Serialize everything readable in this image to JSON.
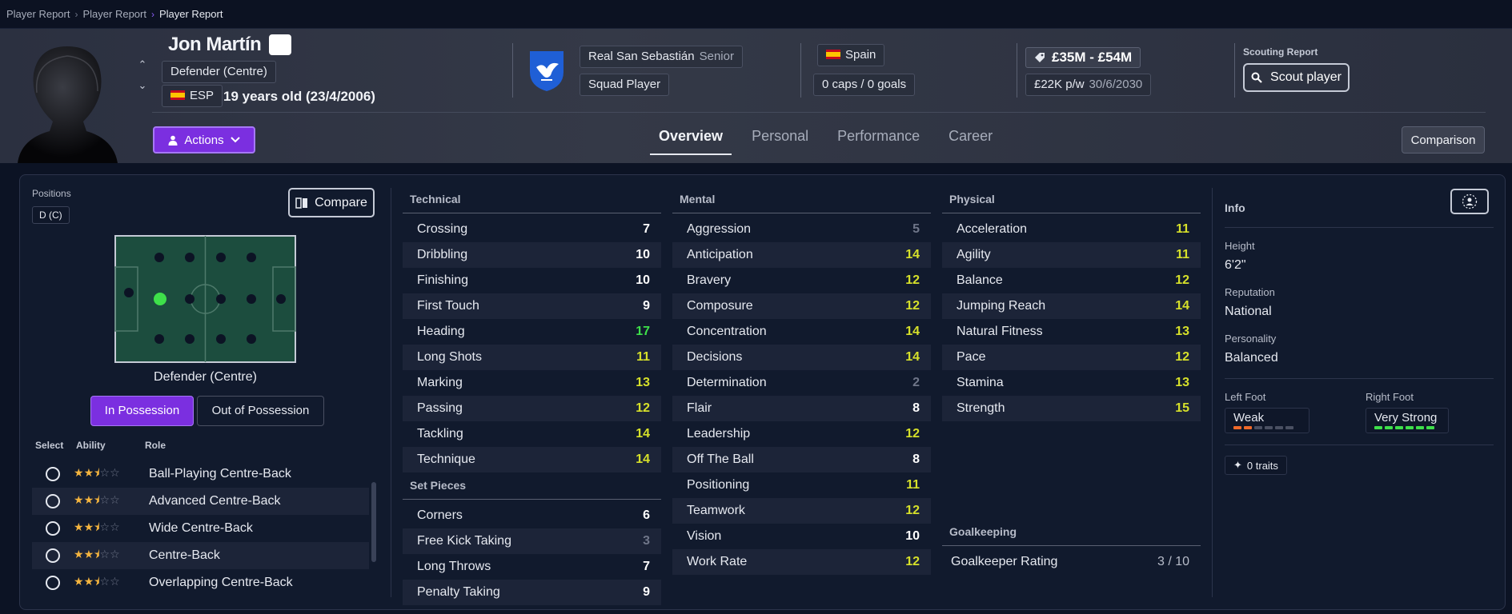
{
  "breadcrumb": {
    "items": [
      "Player Report",
      "Player Report"
    ],
    "current": "Player Report"
  },
  "player": {
    "name": "Jon Martín",
    "position": "Defender (Centre)",
    "nation_code": "ESP",
    "age_text": "19 years old (23/4/2006)",
    "club": "Real San Sebastián",
    "squad": "Senior",
    "squad_status": "Squad Player",
    "nation": "Spain",
    "caps": "0 caps / 0 goals",
    "value": "£35M - £54M",
    "wage": "£22K p/w",
    "contract_end": "30/6/2030"
  },
  "header": {
    "scouting_label": "Scouting Report",
    "scout_button": "Scout player",
    "actions_button": "Actions",
    "comparison_button": "Comparison",
    "tabs": [
      "Overview",
      "Personal",
      "Performance",
      "Career"
    ],
    "active_tab": "Overview"
  },
  "positions": {
    "label": "Positions",
    "chip": "D (C)",
    "compare_button": "Compare",
    "pitch_position_name": "Defender (Centre)",
    "possession_on": "In Possession",
    "possession_off": "Out of Possession"
  },
  "roles": {
    "columns": [
      "Select",
      "Ability",
      "Role"
    ],
    "items": [
      {
        "name": "Ball-Playing Centre-Back",
        "stars": 2.5
      },
      {
        "name": "Advanced Centre-Back",
        "stars": 2.5
      },
      {
        "name": "Wide Centre-Back",
        "stars": 2.5
      },
      {
        "name": "Centre-Back",
        "stars": 2.5
      },
      {
        "name": "Overlapping Centre-Back",
        "stars": 2.5
      }
    ]
  },
  "attributes": {
    "technical": {
      "title": "Technical",
      "items": [
        {
          "name": "Crossing",
          "value": "7"
        },
        {
          "name": "Dribbling",
          "value": "10"
        },
        {
          "name": "Finishing",
          "value": "10"
        },
        {
          "name": "First Touch",
          "value": "9"
        },
        {
          "name": "Heading",
          "value": "17"
        },
        {
          "name": "Long Shots",
          "value": "11"
        },
        {
          "name": "Marking",
          "value": "13"
        },
        {
          "name": "Passing",
          "value": "12"
        },
        {
          "name": "Tackling",
          "value": "14"
        },
        {
          "name": "Technique",
          "value": "14"
        }
      ]
    },
    "set_pieces": {
      "title": "Set Pieces",
      "items": [
        {
          "name": "Corners",
          "value": "6"
        },
        {
          "name": "Free Kick Taking",
          "value": "3"
        },
        {
          "name": "Long Throws",
          "value": "7"
        },
        {
          "name": "Penalty Taking",
          "value": "9"
        }
      ]
    },
    "mental": {
      "title": "Mental",
      "items": [
        {
          "name": "Aggression",
          "value": "5"
        },
        {
          "name": "Anticipation",
          "value": "14"
        },
        {
          "name": "Bravery",
          "value": "12"
        },
        {
          "name": "Composure",
          "value": "12"
        },
        {
          "name": "Concentration",
          "value": "14"
        },
        {
          "name": "Decisions",
          "value": "14"
        },
        {
          "name": "Determination",
          "value": "2"
        },
        {
          "name": "Flair",
          "value": "8"
        },
        {
          "name": "Leadership",
          "value": "12"
        },
        {
          "name": "Off The Ball",
          "value": "8"
        },
        {
          "name": "Positioning",
          "value": "11"
        },
        {
          "name": "Teamwork",
          "value": "12"
        },
        {
          "name": "Vision",
          "value": "10"
        },
        {
          "name": "Work Rate",
          "value": "12"
        }
      ]
    },
    "physical": {
      "title": "Physical",
      "items": [
        {
          "name": "Acceleration",
          "value": "11"
        },
        {
          "name": "Agility",
          "value": "11"
        },
        {
          "name": "Balance",
          "value": "12"
        },
        {
          "name": "Jumping Reach",
          "value": "14"
        },
        {
          "name": "Natural Fitness",
          "value": "13"
        },
        {
          "name": "Pace",
          "value": "12"
        },
        {
          "name": "Stamina",
          "value": "13"
        },
        {
          "name": "Strength",
          "value": "15"
        }
      ]
    },
    "goalkeeping": {
      "title": "Goalkeeping",
      "items": [
        {
          "name": "Goalkeeper Rating",
          "value": "3 / 10"
        }
      ]
    }
  },
  "info": {
    "title": "Info",
    "height_label": "Height",
    "height": "6'2\"",
    "reputation_label": "Reputation",
    "reputation": "National",
    "personality_label": "Personality",
    "personality": "Balanced",
    "left_foot_label": "Left Foot",
    "left_foot": "Weak",
    "left_foot_level": 2,
    "right_foot_label": "Right Foot",
    "right_foot": "Very Strong",
    "right_foot_level": 6,
    "traits": "0 traits"
  },
  "colors": {
    "accent": "#7b2fe0",
    "value_white": "#ffffff",
    "value_yellow": "#d6e02a",
    "value_green": "#3ee04a",
    "value_dim": "#6f7689",
    "star": "#f5b53f"
  }
}
